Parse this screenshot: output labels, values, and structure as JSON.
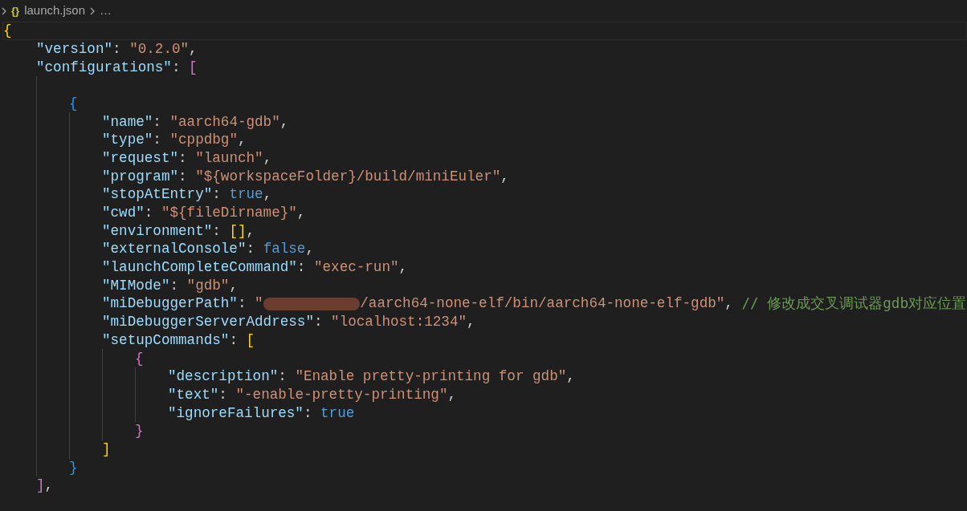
{
  "breadcrumb": {
    "items": [
      {
        "kind": "file",
        "icon": "{}",
        "text": "launch.json"
      },
      {
        "kind": "more",
        "text": "…"
      }
    ]
  },
  "lines": [
    {
      "current": true,
      "tokens": [
        {
          "kind": "bracket",
          "text": "{",
          "color": "#ffd700"
        }
      ],
      "children": [
        {
          "tokens": [
            {
              "kind": "key",
              "text": "\"version\""
            },
            {
              "kind": "punct",
              "text": ": "
            },
            {
              "kind": "string",
              "text": "\"0.2.0\""
            },
            {
              "kind": "punct",
              "text": ","
            }
          ]
        },
        {
          "tokens": [
            {
              "kind": "key",
              "text": "\"configurations\""
            },
            {
              "kind": "punct",
              "text": ": "
            },
            {
              "kind": "bracket",
              "text": "[",
              "color": "#da70d6"
            }
          ],
          "children": [
            {
              "blank_before": true,
              "tokens": [
                {
                  "kind": "bracket",
                  "text": "{",
                  "color": "#179fff"
                }
              ],
              "children": [
                {
                  "tokens": [
                    {
                      "kind": "key",
                      "text": "\"name\""
                    },
                    {
                      "kind": "punct",
                      "text": ": "
                    },
                    {
                      "kind": "string",
                      "text": "\"aarch64-gdb\""
                    },
                    {
                      "kind": "punct",
                      "text": ","
                    }
                  ]
                },
                {
                  "tokens": [
                    {
                      "kind": "key",
                      "text": "\"type\""
                    },
                    {
                      "kind": "punct",
                      "text": ": "
                    },
                    {
                      "kind": "string",
                      "text": "\"cppdbg\""
                    },
                    {
                      "kind": "punct",
                      "text": ","
                    }
                  ]
                },
                {
                  "tokens": [
                    {
                      "kind": "key",
                      "text": "\"request\""
                    },
                    {
                      "kind": "punct",
                      "text": ": "
                    },
                    {
                      "kind": "string",
                      "text": "\"launch\""
                    },
                    {
                      "kind": "punct",
                      "text": ","
                    }
                  ]
                },
                {
                  "tokens": [
                    {
                      "kind": "key",
                      "text": "\"program\""
                    },
                    {
                      "kind": "punct",
                      "text": ": "
                    },
                    {
                      "kind": "string",
                      "text": "\"${workspaceFolder}/build/miniEuler\""
                    },
                    {
                      "kind": "punct",
                      "text": ","
                    }
                  ]
                },
                {
                  "tokens": [
                    {
                      "kind": "key",
                      "text": "\"stopAtEntry\""
                    },
                    {
                      "kind": "punct",
                      "text": ": "
                    },
                    {
                      "kind": "bool",
                      "text": "true"
                    },
                    {
                      "kind": "punct",
                      "text": ","
                    }
                  ]
                },
                {
                  "tokens": [
                    {
                      "kind": "key",
                      "text": "\"cwd\""
                    },
                    {
                      "kind": "punct",
                      "text": ": "
                    },
                    {
                      "kind": "string",
                      "text": "\"${fileDirname}\""
                    },
                    {
                      "kind": "punct",
                      "text": ","
                    }
                  ]
                },
                {
                  "tokens": [
                    {
                      "kind": "key",
                      "text": "\"environment\""
                    },
                    {
                      "kind": "punct",
                      "text": ": "
                    },
                    {
                      "kind": "bracket",
                      "text": "[]",
                      "color": "#ffd700"
                    },
                    {
                      "kind": "punct",
                      "text": ","
                    }
                  ]
                },
                {
                  "tokens": [
                    {
                      "kind": "key",
                      "text": "\"externalConsole\""
                    },
                    {
                      "kind": "punct",
                      "text": ": "
                    },
                    {
                      "kind": "bool",
                      "text": "false"
                    },
                    {
                      "kind": "punct",
                      "text": ","
                    }
                  ]
                },
                {
                  "tokens": [
                    {
                      "kind": "key",
                      "text": "\"launchCompleteCommand\""
                    },
                    {
                      "kind": "punct",
                      "text": ": "
                    },
                    {
                      "kind": "string",
                      "text": "\"exec-run\""
                    },
                    {
                      "kind": "punct",
                      "text": ","
                    }
                  ]
                },
                {
                  "tokens": [
                    {
                      "kind": "key",
                      "text": "\"MIMode\""
                    },
                    {
                      "kind": "punct",
                      "text": ": "
                    },
                    {
                      "kind": "string",
                      "text": "\"gdb\""
                    },
                    {
                      "kind": "punct",
                      "text": ","
                    }
                  ]
                },
                {
                  "tokens": [
                    {
                      "kind": "key",
                      "text": "\"miDebuggerPath\""
                    },
                    {
                      "kind": "punct",
                      "text": ": "
                    },
                    {
                      "kind": "string",
                      "text": "\""
                    },
                    {
                      "kind": "redacted"
                    },
                    {
                      "kind": "string",
                      "text": "/aarch64-none-elf/bin/aarch64-none-elf-gdb\""
                    },
                    {
                      "kind": "punct",
                      "text": ", "
                    },
                    {
                      "kind": "comment",
                      "text": "// 修改成交叉调试器gdb对应位置"
                    }
                  ]
                },
                {
                  "tokens": [
                    {
                      "kind": "key",
                      "text": "\"miDebuggerServerAddress\""
                    },
                    {
                      "kind": "punct",
                      "text": ": "
                    },
                    {
                      "kind": "string",
                      "text": "\"localhost:1234\""
                    },
                    {
                      "kind": "punct",
                      "text": ","
                    }
                  ]
                },
                {
                  "tokens": [
                    {
                      "kind": "key",
                      "text": "\"setupCommands\""
                    },
                    {
                      "kind": "punct",
                      "text": ": "
                    },
                    {
                      "kind": "bracket",
                      "text": "[",
                      "color": "#ffd700"
                    }
                  ],
                  "children": [
                    {
                      "tokens": [
                        {
                          "kind": "bracket",
                          "text": "{",
                          "color": "#da70d6"
                        }
                      ],
                      "children": [
                        {
                          "tokens": [
                            {
                              "kind": "key",
                              "text": "\"description\""
                            },
                            {
                              "kind": "punct",
                              "text": ": "
                            },
                            {
                              "kind": "string",
                              "text": "\"Enable pretty-printing for gdb\""
                            },
                            {
                              "kind": "punct",
                              "text": ","
                            }
                          ]
                        },
                        {
                          "tokens": [
                            {
                              "kind": "key",
                              "text": "\"text\""
                            },
                            {
                              "kind": "punct",
                              "text": ": "
                            },
                            {
                              "kind": "string",
                              "text": "\"-enable-pretty-printing\""
                            },
                            {
                              "kind": "punct",
                              "text": ","
                            }
                          ]
                        },
                        {
                          "tokens": [
                            {
                              "kind": "key",
                              "text": "\"ignoreFailures\""
                            },
                            {
                              "kind": "punct",
                              "text": ": "
                            },
                            {
                              "kind": "bool",
                              "text": "true"
                            }
                          ]
                        }
                      ]
                    },
                    {
                      "tokens": [
                        {
                          "kind": "bracket",
                          "text": "}",
                          "color": "#da70d6"
                        }
                      ]
                    }
                  ]
                },
                {
                  "tokens": [
                    {
                      "kind": "bracket",
                      "text": "]",
                      "color": "#ffd700"
                    }
                  ]
                }
              ]
            },
            {
              "tokens": [
                {
                  "kind": "bracket",
                  "text": "}",
                  "color": "#179fff"
                }
              ]
            }
          ]
        },
        {
          "tokens": [
            {
              "kind": "bracket",
              "text": "]",
              "color": "#da70d6"
            },
            {
              "kind": "punct",
              "text": ","
            }
          ]
        }
      ]
    }
  ]
}
